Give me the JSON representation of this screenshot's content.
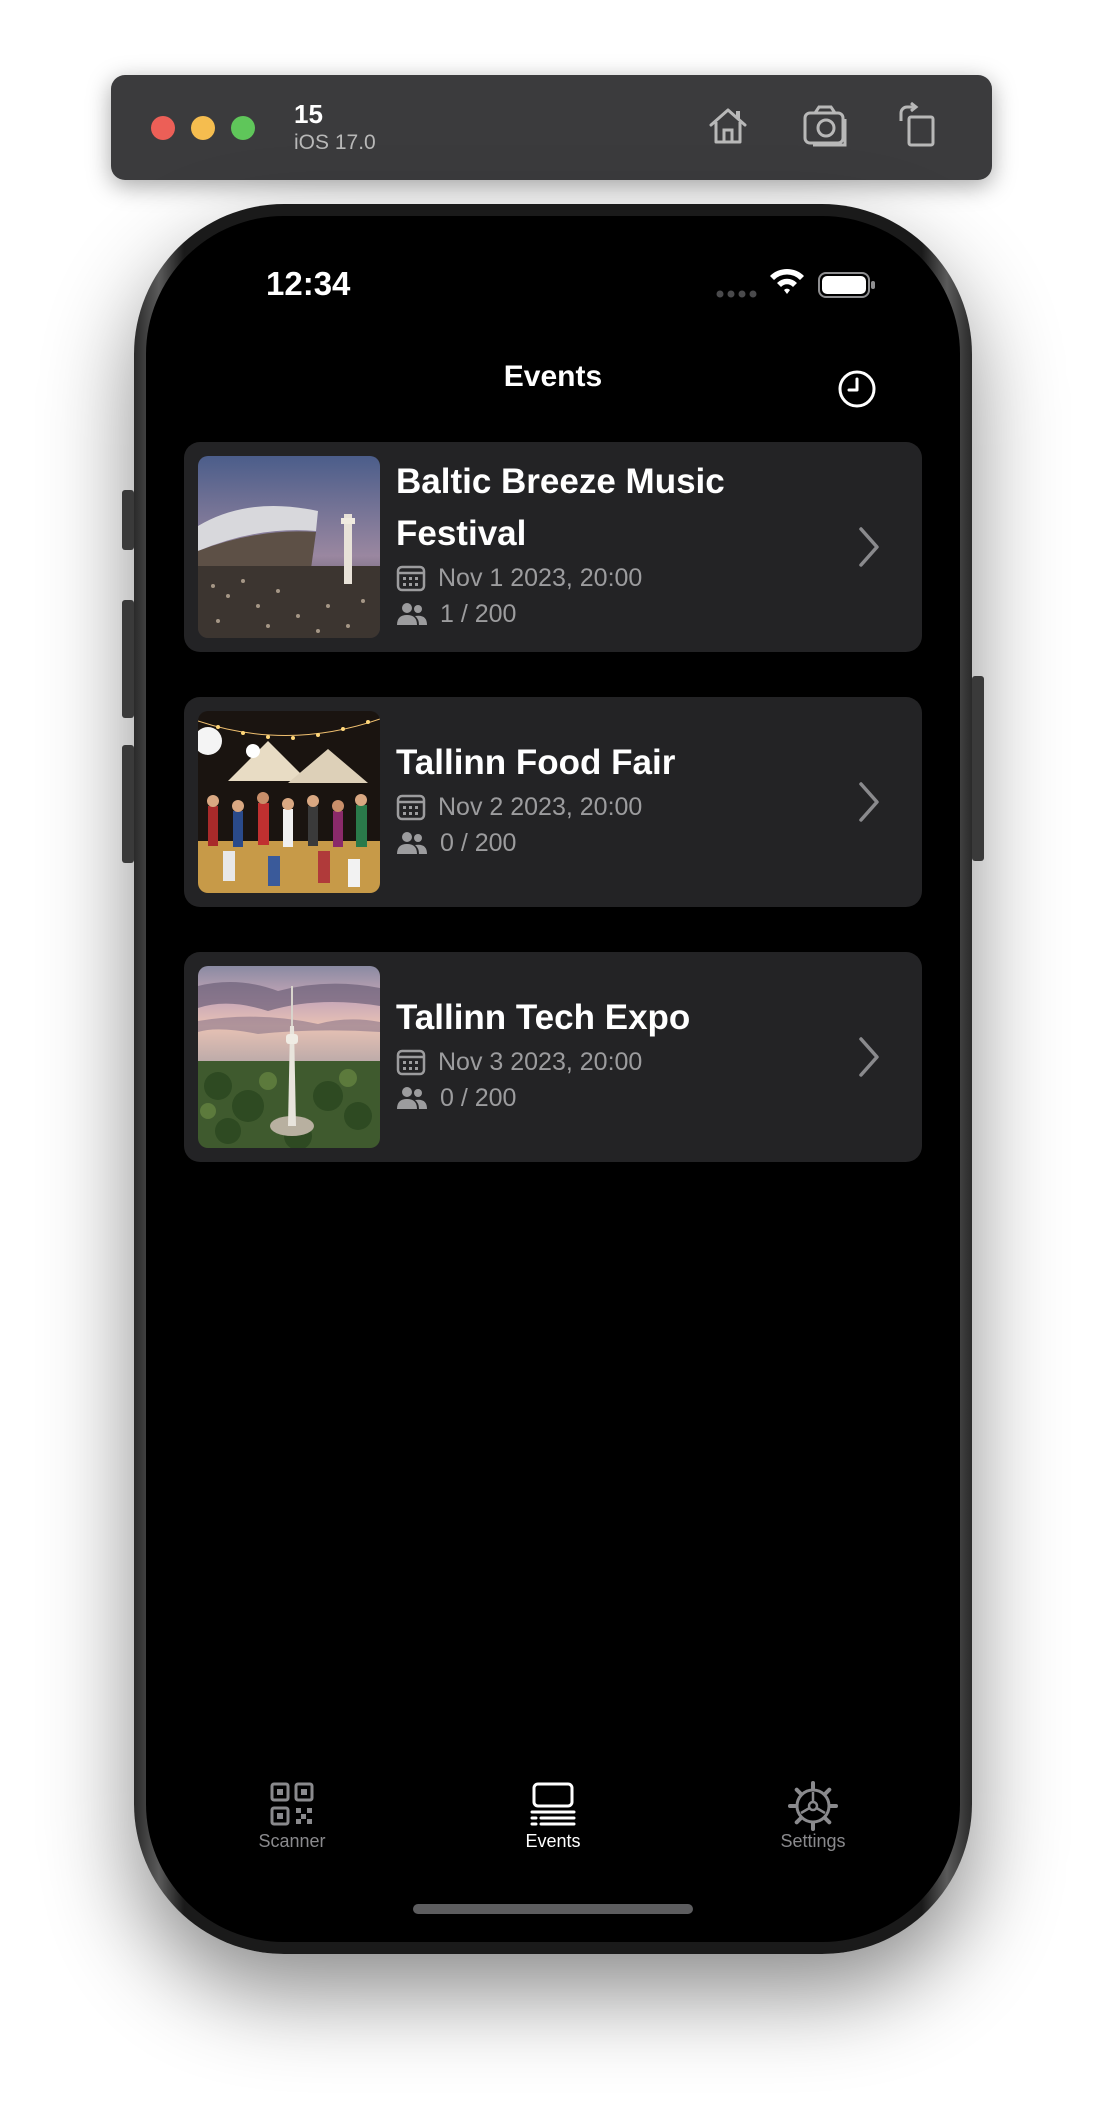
{
  "simulator": {
    "device_name": "15",
    "os_version": "iOS 17.0",
    "icons": [
      "home-icon",
      "screenshot-icon",
      "rotate-icon"
    ]
  },
  "status_bar": {
    "time": "12:34"
  },
  "nav": {
    "title": "Events",
    "right_icon": "history-icon"
  },
  "events": [
    {
      "title": "Baltic Breeze Music Festival",
      "date": "Nov 1 2023, 20:00",
      "attendance": "1 / 200",
      "image": "concert-stadium-image"
    },
    {
      "title": "Tallinn Food Fair",
      "date": "Nov 2 2023, 20:00",
      "attendance": "0 / 200",
      "image": "food-fair-image"
    },
    {
      "title": "Tallinn Tech Expo",
      "date": "Nov 3 2023, 20:00",
      "attendance": "0 / 200",
      "image": "tv-tower-image"
    }
  ],
  "tabbar": {
    "tabs": [
      {
        "label": "Scanner",
        "icon": "qr-code-icon",
        "active": false
      },
      {
        "label": "Events",
        "icon": "list-icon",
        "active": true
      },
      {
        "label": "Settings",
        "icon": "gear-icon",
        "active": false
      }
    ]
  },
  "colors": {
    "background": "#000000",
    "card": "#232325",
    "secondary_text": "#9c9c9e",
    "tab_inactive": "#8a8a8d"
  }
}
